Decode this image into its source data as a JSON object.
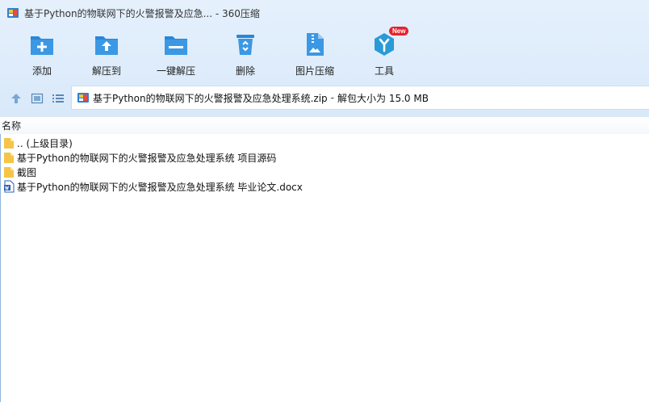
{
  "window": {
    "title": "基于Python的物联网下的火警报警及应急... - 360压缩"
  },
  "toolbar": [
    {
      "label": "添加",
      "icon": "add-icon"
    },
    {
      "label": "解压到",
      "icon": "extract-to-icon"
    },
    {
      "label": "一键解压",
      "icon": "one-click-extract-icon"
    },
    {
      "label": "删除",
      "icon": "delete-icon"
    },
    {
      "label": "图片压缩",
      "icon": "image-compress-icon"
    },
    {
      "label": "工具",
      "icon": "tools-icon",
      "badge": "New"
    }
  ],
  "address": {
    "archive": "基于Python的物联网下的火警报警及应急处理系统.zip",
    "separator": "-",
    "info": "解包大小为 15.0 MB"
  },
  "list": {
    "column_name": "名称",
    "rows": [
      {
        "name": ".. (上级目录)",
        "icon": "folder-icon"
      },
      {
        "name": "基于Python的物联网下的火警报警及应急处理系统 项目源码",
        "icon": "folder-icon"
      },
      {
        "name": "截图",
        "icon": "folder-icon"
      },
      {
        "name": "基于Python的物联网下的火警报警及应急处理系统 毕业论文.docx",
        "icon": "word-document-icon"
      }
    ]
  },
  "colors": {
    "accent_blue": "#2a86d6",
    "badge_red": "#e5232e",
    "folder_yellow": "#f6c447"
  }
}
